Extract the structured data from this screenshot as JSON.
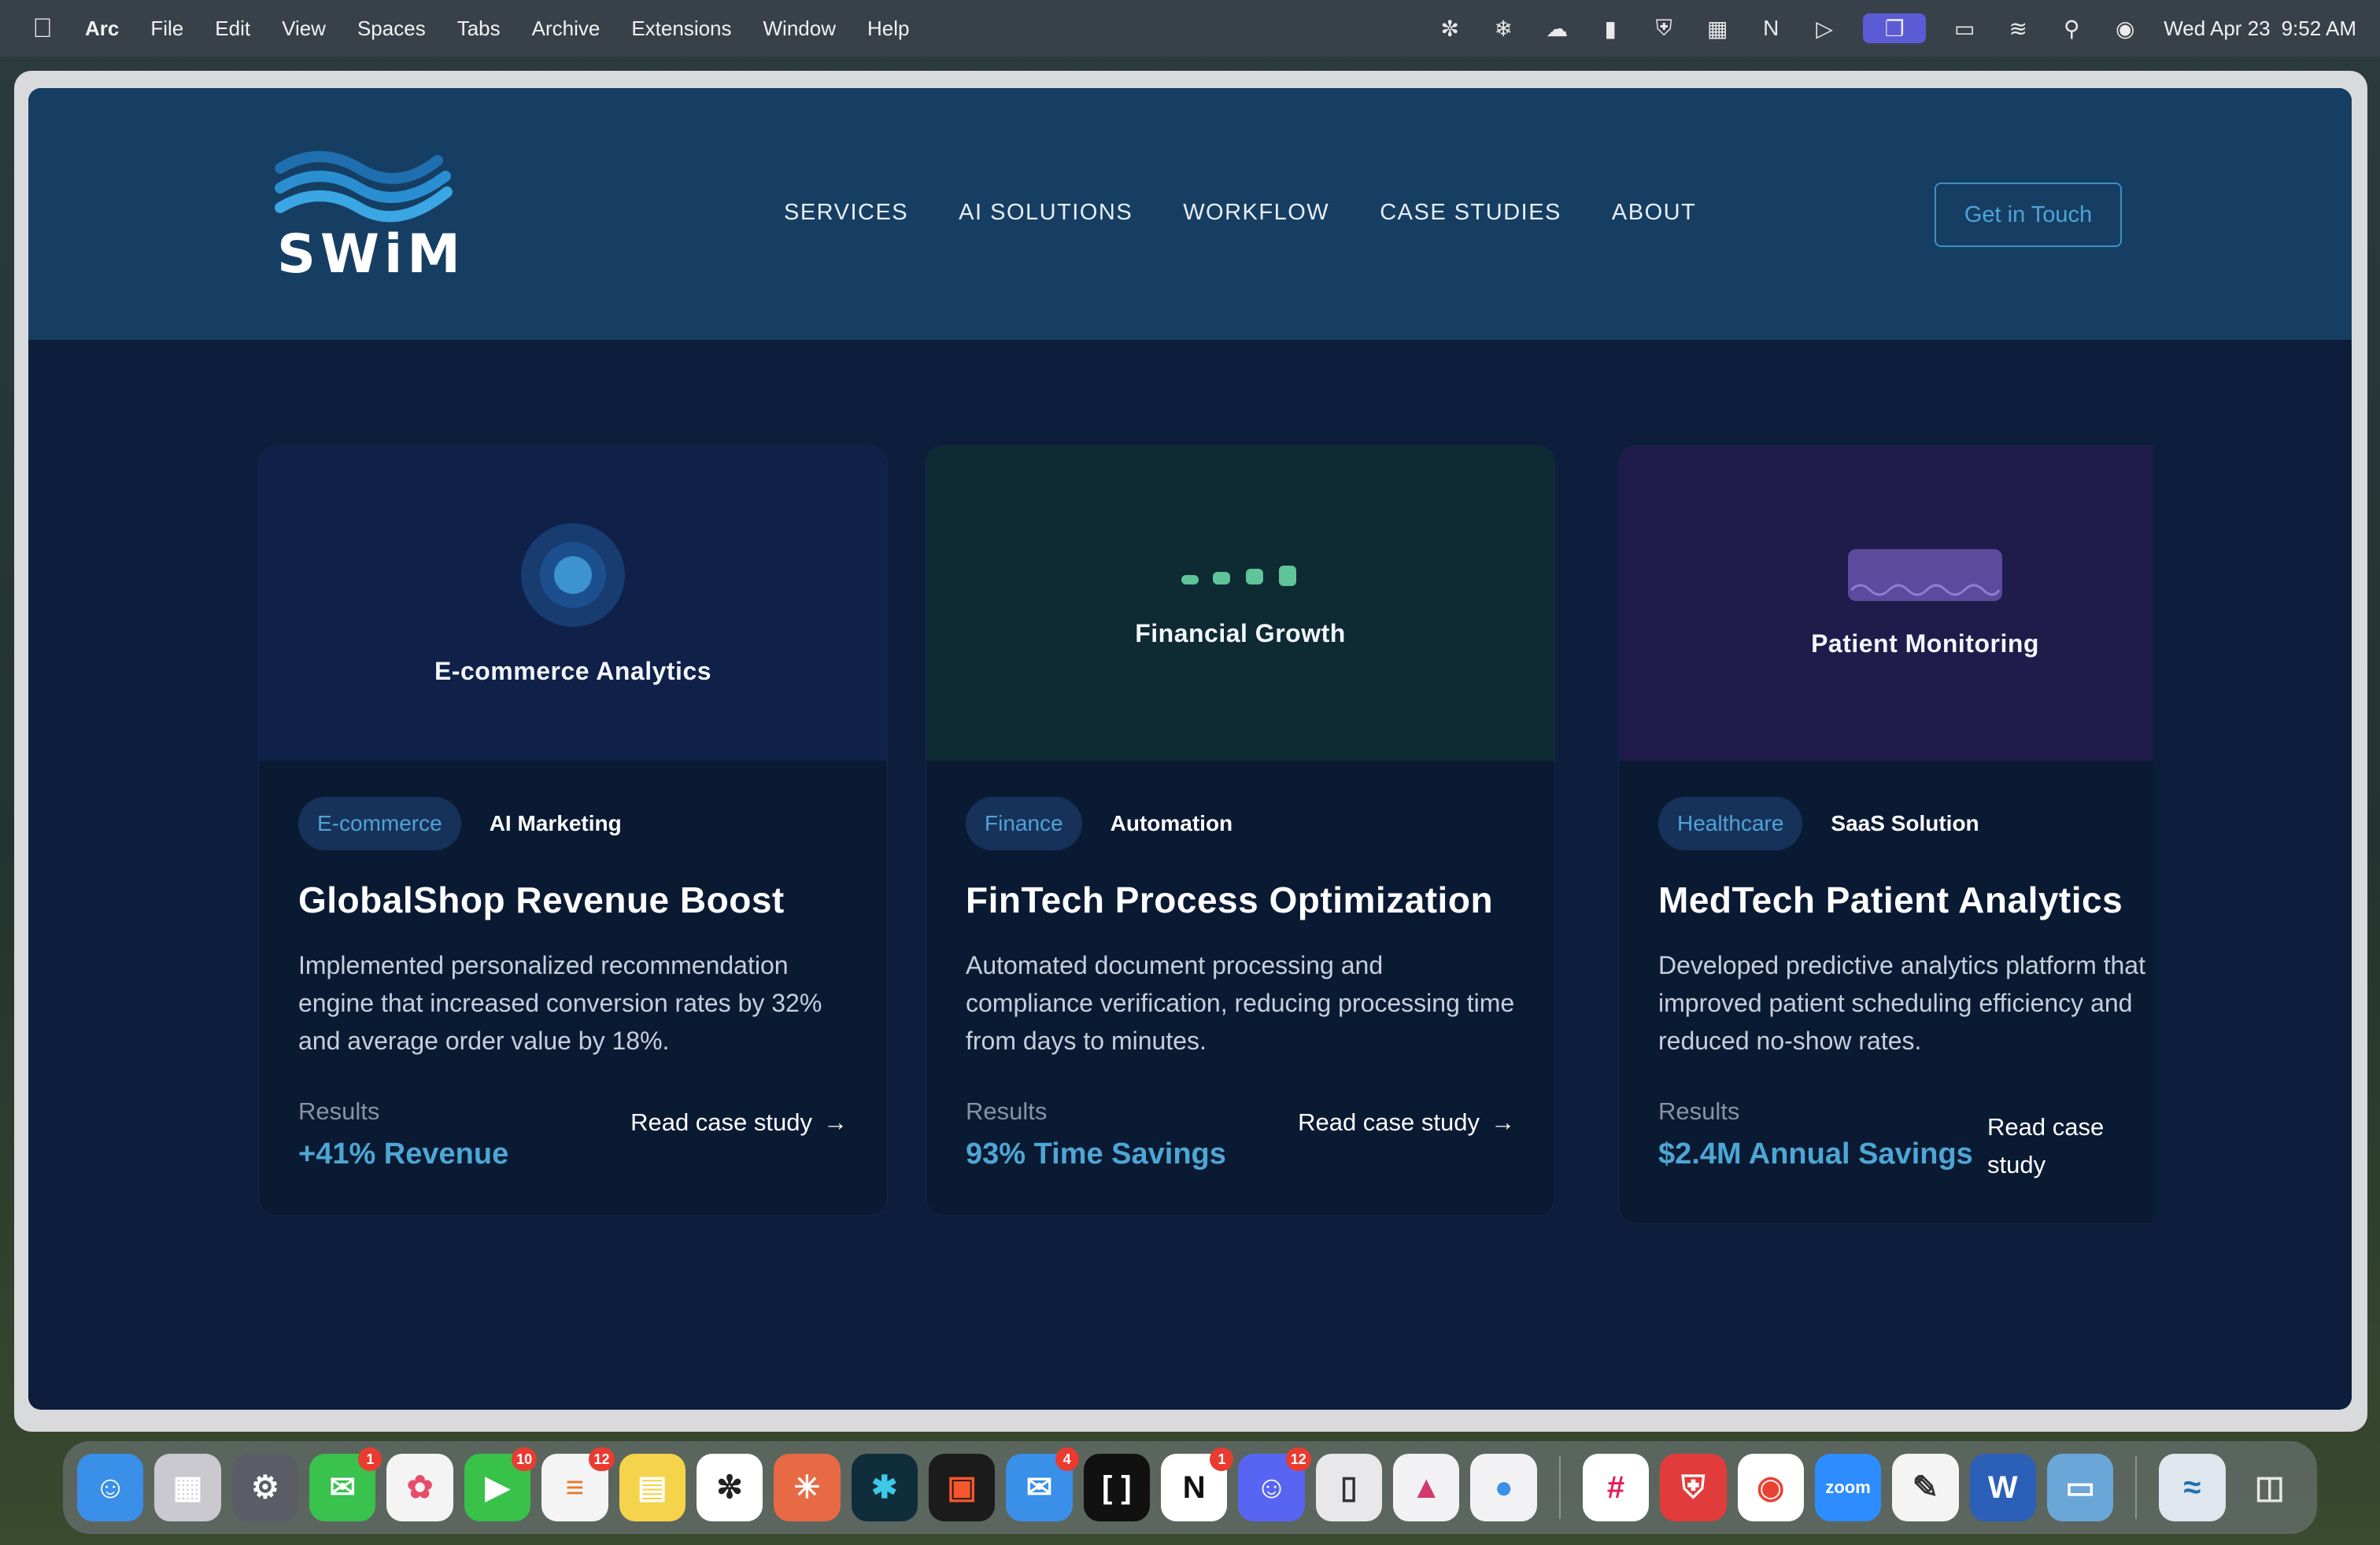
{
  "menubar": {
    "app_name": "Arc",
    "items": [
      "File",
      "Edit",
      "View",
      "Spaces",
      "Tabs",
      "Archive",
      "Extensions",
      "Window",
      "Help"
    ],
    "date": "Wed Apr 23",
    "time": "9:52 AM"
  },
  "site": {
    "logo_text": "SWiM",
    "nav": [
      "SERVICES",
      "AI SOLUTIONS",
      "WORKFLOW",
      "CASE STUDIES",
      "ABOUT"
    ],
    "cta_label": "Get in Touch"
  },
  "cards": [
    {
      "media_label": "E-commerce Analytics",
      "tag_primary": "E-commerce",
      "tag_secondary": "AI Marketing",
      "title": "GlobalShop Revenue Boost",
      "description": "Implemented personalized recommendation engine that increased conversion rates by 32% and average order value by 18%.",
      "results_label": "Results",
      "results_value": "+41% Revenue",
      "link_label": "Read case study"
    },
    {
      "media_label": "Financial Growth",
      "tag_primary": "Finance",
      "tag_secondary": "Automation",
      "title": "FinTech Process Optimization",
      "description": "Automated document processing and compliance verification, reducing processing time from days to minutes.",
      "results_label": "Results",
      "results_value": "93% Time Savings",
      "link_label": "Read case study"
    },
    {
      "media_label": "Patient Monitoring",
      "tag_primary": "Healthcare",
      "tag_secondary": "SaaS Solution",
      "title": "MedTech Patient Analytics",
      "description": "Developed predictive analytics platform that improved patient scheduling efficiency and reduced no-show rates.",
      "results_label": "Results",
      "results_value": "$2.4M Annual Savings",
      "link_label": "Read case study"
    }
  ],
  "dock": {
    "badges": {
      "messages": "1",
      "facetime": "10",
      "reminders": "12",
      "mail": "4",
      "notion": "1",
      "discord": "12"
    }
  },
  "colors": {
    "accent": "#4fa3d6",
    "header_bg": "#163e63",
    "page_bg": "#0c1e3b"
  }
}
